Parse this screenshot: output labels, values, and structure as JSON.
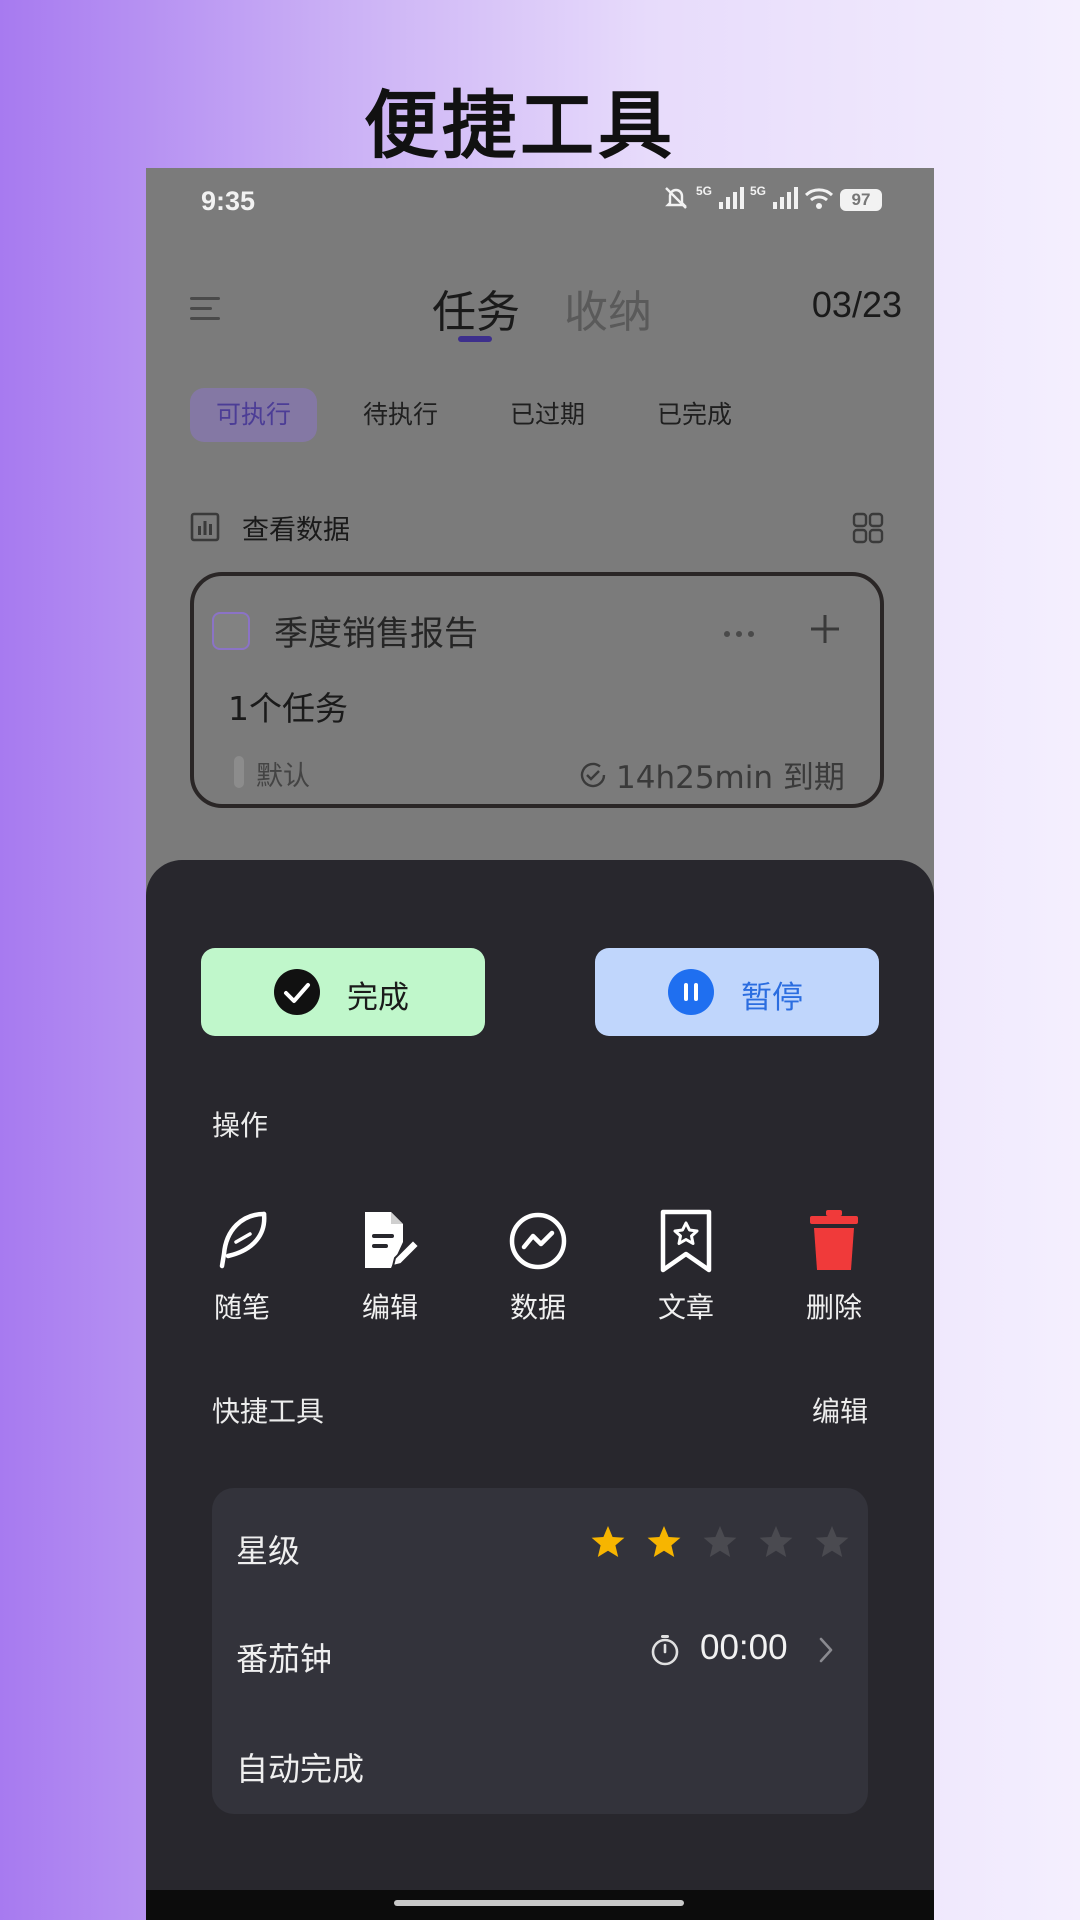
{
  "page_title": "便捷工具",
  "status_bar": {
    "time": "9:35",
    "network_1": "5G",
    "network_2": "5G",
    "battery": "97",
    "icons": [
      "mute-icon",
      "signal-icon",
      "signal-icon",
      "wifi-icon",
      "battery-icon"
    ]
  },
  "header": {
    "tabs": [
      {
        "label": "任务",
        "active": true
      },
      {
        "label": "收纳",
        "active": false
      }
    ],
    "date": "03/23"
  },
  "filters": [
    {
      "label": "可执行",
      "active": true
    },
    {
      "label": "待执行",
      "active": false
    },
    {
      "label": "已过期",
      "active": false
    },
    {
      "label": "已完成",
      "active": false
    }
  ],
  "data_row": {
    "label": "查看数据"
  },
  "task_card": {
    "title": "季度销售报告",
    "task_count": "1个任务",
    "tag": "默认",
    "due": "14h25min 到期"
  },
  "sheet": {
    "complete_label": "完成",
    "pause_label": "暂停",
    "operations_title": "操作",
    "operations": [
      {
        "label": "随笔",
        "icon": "quill-icon"
      },
      {
        "label": "编辑",
        "icon": "edit-document-icon"
      },
      {
        "label": "数据",
        "icon": "chart-icon"
      },
      {
        "label": "文章",
        "icon": "bookmark-icon"
      },
      {
        "label": "删除",
        "icon": "trash-icon"
      }
    ],
    "quick_tools_title": "快捷工具",
    "quick_tools_edit": "编辑",
    "quick_tools": {
      "rating_label": "星级",
      "rating_value": 2,
      "rating_max": 5,
      "pomodoro_label": "番茄钟",
      "pomodoro_time": "00:00",
      "auto_complete_label": "自动完成"
    }
  },
  "colors": {
    "complete_bg": "#c0f7cb",
    "pause_bg": "#c0d6fc",
    "pause_accent": "#2b6de0",
    "delete_red": "#f03a3a",
    "star_active": "#f7b500",
    "star_inactive": "#4a4a50",
    "sheet_bg": "#28272d"
  }
}
